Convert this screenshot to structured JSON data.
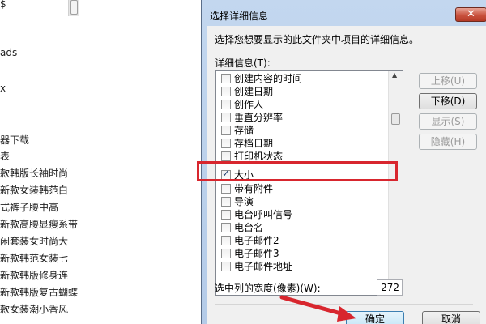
{
  "background": {
    "left_items": [
      "器下载",
      "款韩版长袖时尚",
      "新款女装韩范白",
      "式裤子腰中高",
      "新款高腰显瘦系带",
      "闲套装女时尚大",
      "新款韩范女装七",
      "新款韩版修身连",
      "新款韩版复古蝴蝶",
      "款女装潮小香风"
    ],
    "left_fragments": [
      "$",
      "ads",
      "x",
      "表"
    ]
  },
  "dialog": {
    "title": "选择详细信息",
    "close_label": "✕",
    "instruction": "选择您想要显示的此文件夹中项目的详细信息。",
    "list_label": "详细信息(T):",
    "items": [
      {
        "label": "创建内容的时间",
        "checked": false
      },
      {
        "label": "创建日期",
        "checked": false
      },
      {
        "label": "创作人",
        "checked": false
      },
      {
        "label": "垂直分辨率",
        "checked": false
      },
      {
        "label": "存储",
        "checked": false
      },
      {
        "label": "存档日期",
        "checked": false
      },
      {
        "label": "打印机状态",
        "checked": false
      },
      {
        "label": "大小",
        "checked": true
      },
      {
        "label": "带有附件",
        "checked": false
      },
      {
        "label": "导演",
        "checked": false
      },
      {
        "label": "电台呼叫信号",
        "checked": false
      },
      {
        "label": "电台名",
        "checked": false
      },
      {
        "label": "电子邮件2",
        "checked": false
      },
      {
        "label": "电子邮件3",
        "checked": false
      },
      {
        "label": "电子邮件地址",
        "checked": false
      }
    ],
    "move_up": "上移(U)",
    "move_down": "下移(D)",
    "show": "显示(S)",
    "hide": "隐藏(H)",
    "width_label": "选中列的宽度(像素)(W):",
    "width_value": "272",
    "ok": "确定",
    "cancel": "取消"
  },
  "colors": {
    "annotation": "#d8262e",
    "titlebar": "#c3d7ef",
    "close": "#c9523e"
  }
}
